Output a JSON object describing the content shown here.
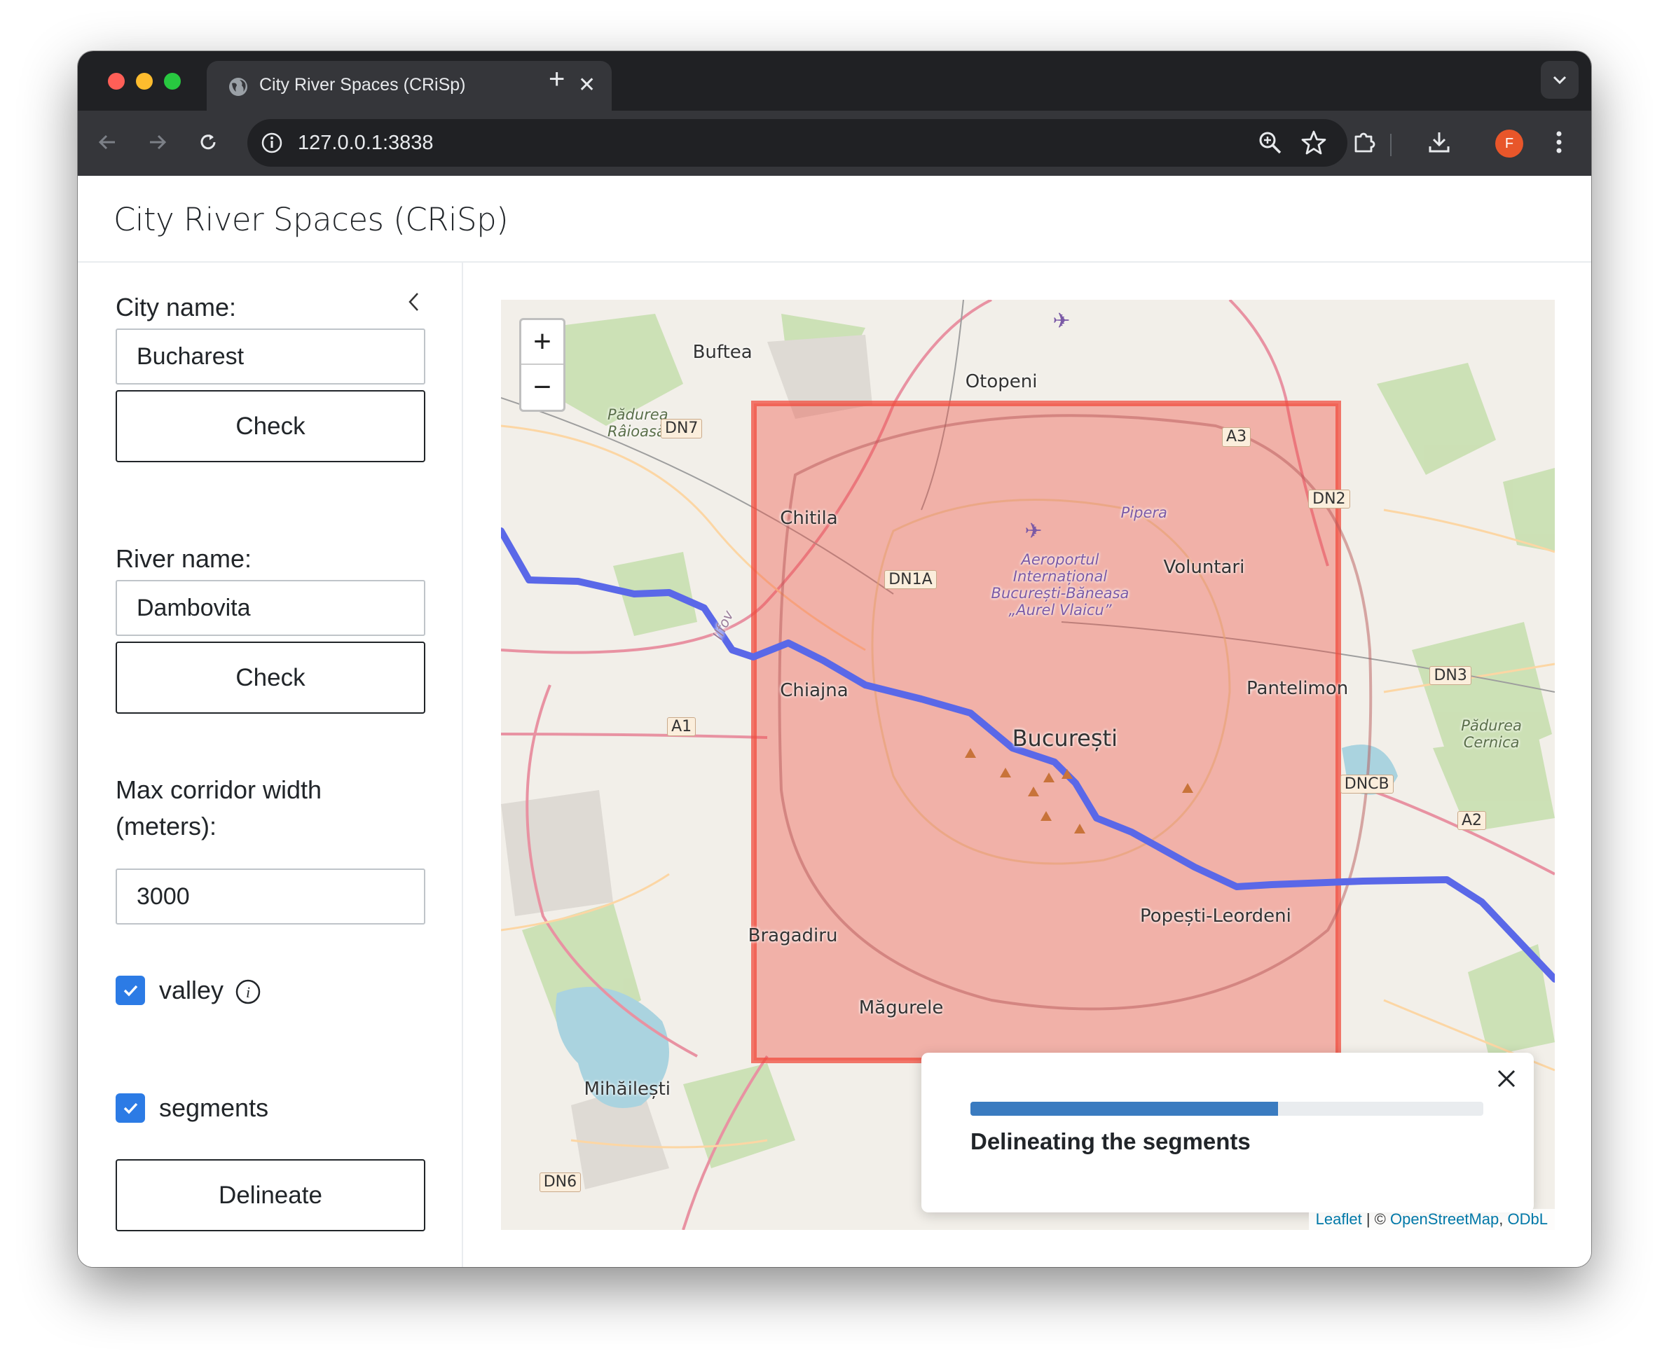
{
  "browser": {
    "tab_title": "City River Spaces (CRiSp)",
    "tab_close": "✕",
    "new_tab": "+",
    "url": "127.0.0.1:3838",
    "profile_initial": "F"
  },
  "app": {
    "title": "City River Spaces (CRiSp)"
  },
  "sidebar": {
    "city_label": "City name:",
    "city_value": "Bucharest",
    "city_check": "Check",
    "river_label": "River name:",
    "river_value": "Dambovita",
    "river_check": "Check",
    "width_label": "Max corridor width (meters):",
    "width_value": "3000",
    "valley_label": "valley",
    "valley_checked": true,
    "segments_label": "segments",
    "segments_checked": true,
    "delineate": "Delineate"
  },
  "map": {
    "zoom_in": "+",
    "zoom_out": "−",
    "labels": [
      "Buftea",
      "Otopeni",
      "Pădurea Râioasă",
      "DN7",
      "A3",
      "DN2",
      "Chitila",
      "Pipera",
      "DN1A",
      "Aeroportul Internațional București-Băneasa „Aurel Vlaicu”",
      "Voluntari",
      "Ilfov",
      "Chiajna",
      "Pantelimon",
      "DN3",
      "Pădurea Cernica",
      "A1",
      "București",
      "DNCB",
      "A2",
      "Popești-Leordeni",
      "Bragadiru",
      "Măgurele",
      "Mihăilești",
      "DN6"
    ],
    "attribution": {
      "leaflet": "Leaflet",
      "sep": " | © ",
      "osm": "OpenStreetMap",
      "comma": ", ",
      "odbl": "ODbL"
    },
    "overlay_color": "#f04c3e",
    "river_color": "#5a68e8"
  },
  "notification": {
    "message": "Delineating the segments",
    "progress": 0.6
  }
}
